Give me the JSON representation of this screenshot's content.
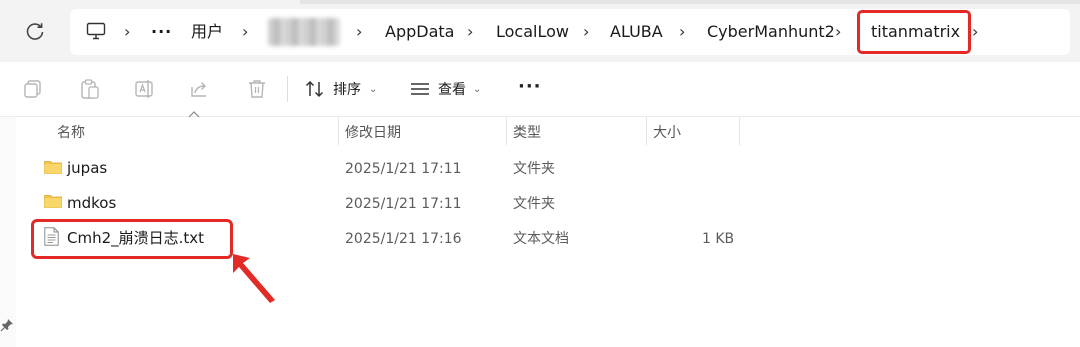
{
  "address_bar": {
    "overflow": "···",
    "segments": [
      "用户",
      "AppData",
      "LocalLow",
      "ALUBA",
      "CyberManhunt2",
      "titanmatrix"
    ],
    "separator": "›"
  },
  "toolbar": {
    "sort_label": "排序",
    "view_label": "查看",
    "more_label": "···",
    "chevron": "⌄"
  },
  "columns": {
    "name": "名称",
    "modified": "修改日期",
    "type": "类型",
    "size": "大小"
  },
  "files": [
    {
      "name": "jupas",
      "modified": "2025/1/21 17:11",
      "type": "文件夹",
      "size": "",
      "kind": "folder"
    },
    {
      "name": "mdkos",
      "modified": "2025/1/21 17:11",
      "type": "文件夹",
      "size": "",
      "kind": "folder"
    },
    {
      "name": "Cmh2_崩溃日志.txt",
      "modified": "2025/1/21 17:16",
      "type": "文本文档",
      "size": "1 KB",
      "kind": "text"
    }
  ],
  "colors": {
    "highlight": "#e32a26",
    "folder": "#f2c44c"
  }
}
